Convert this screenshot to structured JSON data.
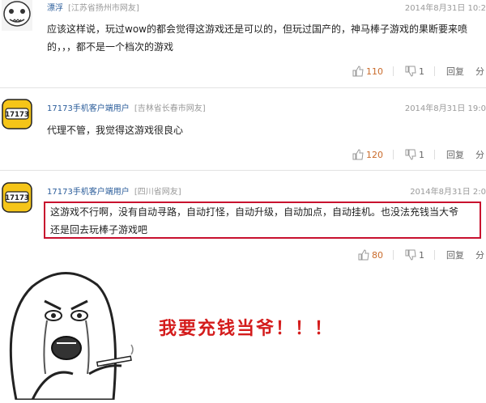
{
  "comments": [
    {
      "user": "漂浮",
      "location": "[江苏省扬州市网友]",
      "time": "2014年8月31日 10:2",
      "lines": [
        "应该这样说，玩过wow的都会觉得这游戏还是可以的，但玩过国产的，神马棒子游戏的果断要来喷",
        "的，，，都不是一个档次的游戏"
      ],
      "up": "110",
      "down": "1",
      "reply": "回复",
      "share": "分"
    },
    {
      "user": "17173手机客户端用户",
      "location": "[吉林省长春市网友]",
      "time": "2014年8月31日 19:0",
      "lines": [
        "代理不管，我觉得这游戏很良心"
      ],
      "up": "120",
      "down": "1",
      "reply": "回复",
      "share": "分"
    },
    {
      "user": "17173手机客户端用户",
      "location": "[四川省网友]",
      "time": "2014年8月31日 2:0",
      "lines": [
        "这游戏不行啊，没有自动寻路，自动打怪，自动升级，自动加点，自动挂机。也没法充钱当大爷",
        "还是回去玩棒子游戏吧"
      ],
      "up": "80",
      "down": "1",
      "reply": "回复",
      "share": "分"
    }
  ],
  "avatar_logo_text": "17173",
  "meme_caption": "我要充钱当爷！！！",
  "colors": {
    "highlight": "#c8102e",
    "caption": "#d41c1c",
    "username": "#2a5c9a"
  }
}
